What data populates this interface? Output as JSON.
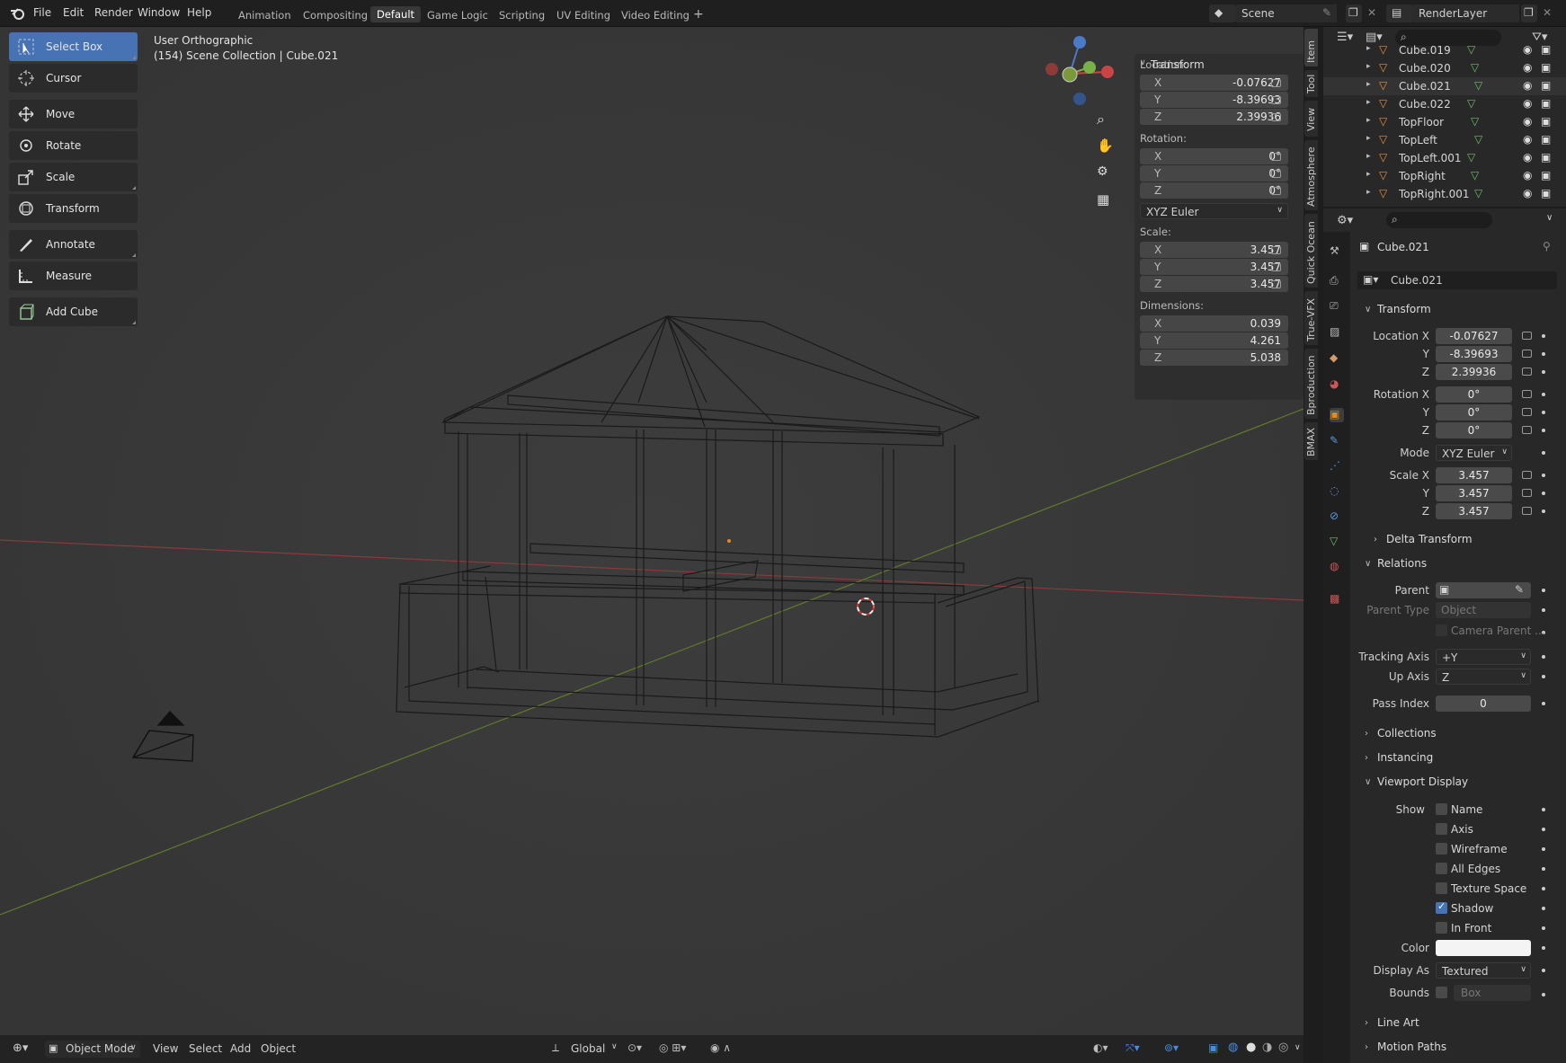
{
  "menu": {
    "items": [
      "File",
      "Edit",
      "Render",
      "Window",
      "Help"
    ]
  },
  "workspaces": {
    "tabs": [
      "Animation",
      "Compositing",
      "Default",
      "Game Logic",
      "Scripting",
      "UV Editing",
      "Video Editing"
    ],
    "active": "Default",
    "add": "+"
  },
  "scene": {
    "name": "Scene",
    "render_layer": "RenderLayer"
  },
  "viewport": {
    "view_name": "User Orthographic",
    "collection_info": "(154) Scene Collection | Cube.021"
  },
  "tools": [
    "Select Box",
    "Cursor",
    "Move",
    "Rotate",
    "Scale",
    "Transform",
    "Annotate",
    "Measure",
    "Add Cube"
  ],
  "npanel": {
    "title": "Transform",
    "location_label": "Location:",
    "location": {
      "x": "-0.07627",
      "y": "-8.39693",
      "z": "2.39936"
    },
    "rotation_label": "Rotation:",
    "rotation": {
      "x": "0°",
      "y": "0°",
      "z": "0°"
    },
    "rotation_mode": "XYZ Euler",
    "scale_label": "Scale:",
    "scale": {
      "x": "3.457",
      "y": "3.457",
      "z": "3.457"
    },
    "dimensions_label": "Dimensions:",
    "dimensions": {
      "x": "0.039",
      "y": "4.261",
      "z": "5.038"
    },
    "axis_labels": {
      "x": "X",
      "y": "Y",
      "z": "Z"
    }
  },
  "side_tabs": [
    "Item",
    "Tool",
    "View",
    "Atmosphere",
    "Quick Ocean",
    "True-VFX",
    "Bproduction",
    "BMAX"
  ],
  "outliner": {
    "items": [
      "Cube.019",
      "Cube.020",
      "Cube.021",
      "Cube.022",
      "TopFloor",
      "TopLeft",
      "TopLeft.001",
      "TopRight",
      "TopRight.001"
    ]
  },
  "properties": {
    "object_name": "Cube.021",
    "object_field": "Cube.021",
    "transform_title": "Transform",
    "location_x_label": "Location X",
    "y_label": "Y",
    "z_label": "Z",
    "location": {
      "x": "-0.07627",
      "y": "-8.39693",
      "z": "2.39936"
    },
    "rotation_x_label": "Rotation X",
    "rotation": {
      "x": "0°",
      "y": "0°",
      "z": "0°"
    },
    "mode_label": "Mode",
    "mode_value": "XYZ Euler",
    "scale_x_label": "Scale X",
    "scale": {
      "x": "3.457",
      "y": "3.457",
      "z": "3.457"
    },
    "delta_transform": "Delta Transform",
    "relations_title": "Relations",
    "parent_label": "Parent",
    "parent_type_label": "Parent Type",
    "parent_type_value": "Object",
    "camera_parent": "Camera Parent ...",
    "tracking_axis_label": "Tracking Axis",
    "tracking_axis_value": "+Y",
    "up_axis_label": "Up Axis",
    "up_axis_value": "Z",
    "pass_index_label": "Pass Index",
    "pass_index_value": "0",
    "collections": "Collections",
    "instancing": "Instancing",
    "viewport_display": "Viewport Display",
    "show_label": "Show",
    "show_options": [
      "Name",
      "Axis",
      "Wireframe",
      "All Edges",
      "Texture Space",
      "Shadow",
      "In Front"
    ],
    "color_label": "Color",
    "display_as_label": "Display As",
    "display_as_value": "Textured",
    "bounds_label": "Bounds",
    "bounds_value": "Box",
    "line_art": "Line Art",
    "motion_paths": "Motion Paths"
  },
  "footer": {
    "mode": "Object Mode",
    "menus": [
      "View",
      "Select",
      "Add",
      "Object"
    ],
    "orientation": "Global"
  }
}
